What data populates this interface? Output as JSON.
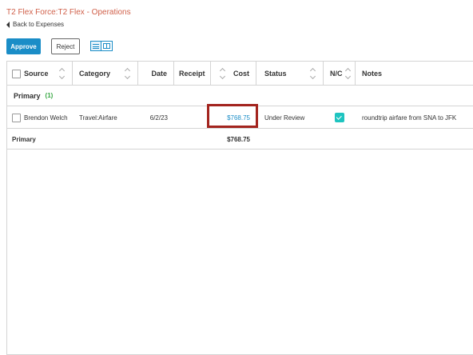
{
  "page": {
    "title": "T2 Flex Force:T2 Flex - Operations",
    "back_label": "Back to Expenses"
  },
  "toolbar": {
    "approve_label": "Approve",
    "reject_label": "Reject",
    "view_icons": [
      "list-view-icon",
      "columns-view-icon"
    ],
    "accent": "#1a8dc7"
  },
  "table": {
    "columns": [
      "Source",
      "Category",
      "Date",
      "Receipt",
      "Cost",
      "Status",
      "N/C",
      "Notes"
    ],
    "group": {
      "name": "Primary",
      "count": "(1)"
    },
    "rows": [
      {
        "source": "Brendon Welch",
        "category": "Travel:Airfare",
        "date": "6/2/23",
        "receipt": "",
        "cost": "$768.75",
        "status": "Under Review",
        "nc_checked": true,
        "notes": "roundtrip airfare from SNA to JFK"
      }
    ],
    "total": {
      "label": "Primary",
      "cost": "$768.75"
    }
  },
  "colors": {
    "title": "#d0604a",
    "group_count": "#3aa845",
    "highlight_box": "#a3241e",
    "checkbox_checked": "#1ec4c0"
  }
}
